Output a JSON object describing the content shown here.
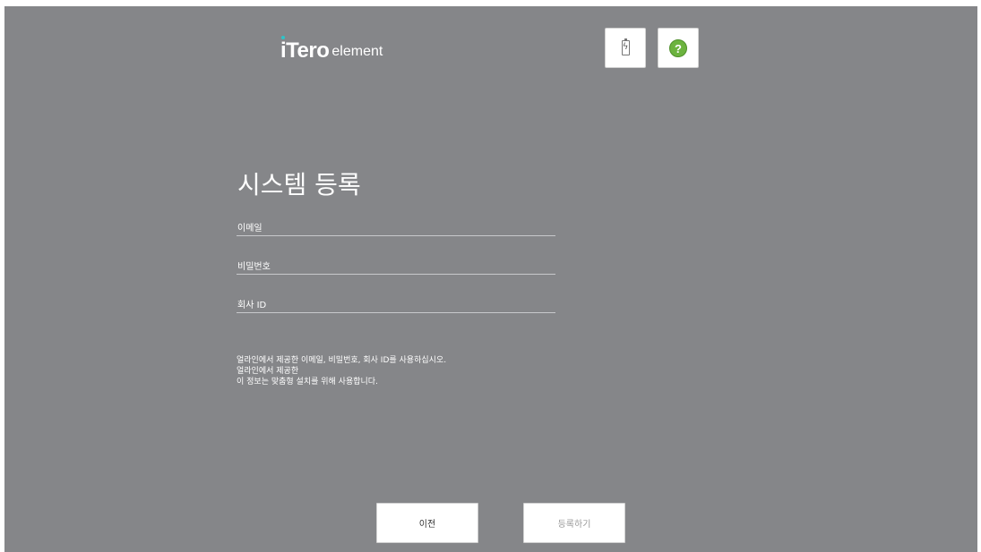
{
  "header": {
    "brand": "iTero",
    "product": "element",
    "battery_icon": "battery-icon",
    "help_icon": "help-icon",
    "help_glyph": "?",
    "help_color": "#6cb33f",
    "brand_accent": "#2ec4c9"
  },
  "page": {
    "title": "시스템 등록",
    "background": "#858689"
  },
  "form": {
    "email": {
      "placeholder": "이메일",
      "value": ""
    },
    "password": {
      "placeholder": "비밀번호",
      "value": ""
    },
    "company_id": {
      "placeholder": "회사 ID",
      "value": ""
    }
  },
  "info": {
    "line1": "얼라인에서 제공한 이메일, 비밀번호, 회사 ID를 사용하십시오.",
    "line2": "얼라인에서 제공한",
    "line3": "이 정보는 맞춤형 설치를 위해 사용합니다."
  },
  "buttons": {
    "back": "이전",
    "register": "등록하기"
  }
}
